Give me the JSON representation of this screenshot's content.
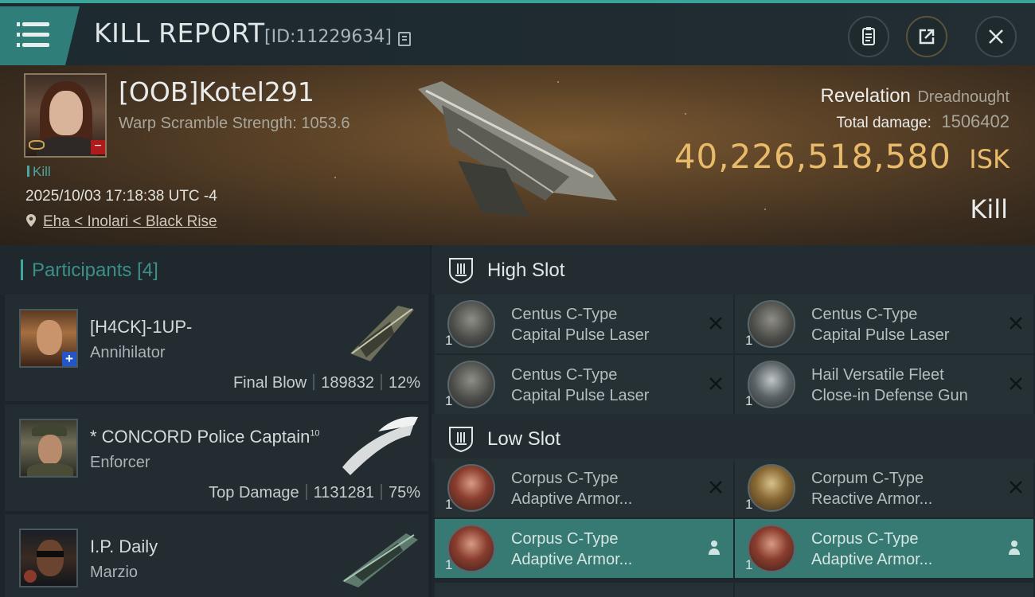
{
  "header": {
    "title": "KILL REPORT",
    "kill_id": "[ID:11229634]",
    "menu_icon": "hamburger-icon",
    "buttons": [
      {
        "name": "clipboard-icon"
      },
      {
        "name": "share-icon"
      },
      {
        "name": "close-icon"
      }
    ]
  },
  "victim": {
    "name": "[OOB]Kotel291",
    "warp_scramble": "Warp Scramble Strength: 1053.6",
    "tag": "Kill",
    "time": "2025/10/03 17:18:38 UTC -4",
    "location": "Eha < Inolari < Black Rise",
    "status_badge": "−"
  },
  "kill": {
    "ship_name": "Revelation",
    "ship_class": "Dreadnought",
    "damage_label": "Total damage:",
    "damage_value": "1506402",
    "isk_value": "40,226,518,580",
    "isk_unit": "ISK",
    "type": "Kill"
  },
  "participants": {
    "title": "Participants",
    "count": "[4]",
    "rows": [
      {
        "name": "[H4CK]-1UP-",
        "sup": "",
        "ship": "Annihilator",
        "label": "Final Blow",
        "damage": "189832",
        "percent": "12%",
        "badge": "+"
      },
      {
        "name": "* CONCORD Police Captain",
        "sup": "10",
        "ship": "Enforcer",
        "label": "Top Damage",
        "damage": "1131281",
        "percent": "75%",
        "badge": ""
      },
      {
        "name": "I.P. Daily",
        "sup": "",
        "ship": "Marzio",
        "label": "",
        "damage": "",
        "percent": "",
        "badge": ""
      }
    ]
  },
  "slots": {
    "high": {
      "title": "High Slot",
      "modules": [
        {
          "qty": "1",
          "line1": "Centus C-Type",
          "line2": "Capital Pulse Laser"
        },
        {
          "qty": "1",
          "line1": "Centus C-Type",
          "line2": "Capital Pulse Laser"
        },
        {
          "qty": "1",
          "line1": "Centus C-Type",
          "line2": "Capital Pulse Laser"
        },
        {
          "qty": "1",
          "line1": "Hail Versatile Fleet",
          "line2": "Close-in Defense Gun"
        }
      ]
    },
    "low": {
      "title": "Low Slot",
      "modules": [
        {
          "qty": "1",
          "line1": "Corpus C-Type",
          "line2": "Adaptive Armor..."
        },
        {
          "qty": "1",
          "line1": "Corpum C-Type",
          "line2": "Reactive Armor..."
        },
        {
          "qty": "1",
          "line1": "Corpus C-Type",
          "line2": "Adaptive Armor..."
        },
        {
          "qty": "1",
          "line1": "Corpus C-Type",
          "line2": "Adaptive Armor..."
        }
      ]
    }
  },
  "colors": {
    "accent_teal": "#3aa39a",
    "isk_gold": "#e8bb6a",
    "active_module": "#377a74"
  }
}
